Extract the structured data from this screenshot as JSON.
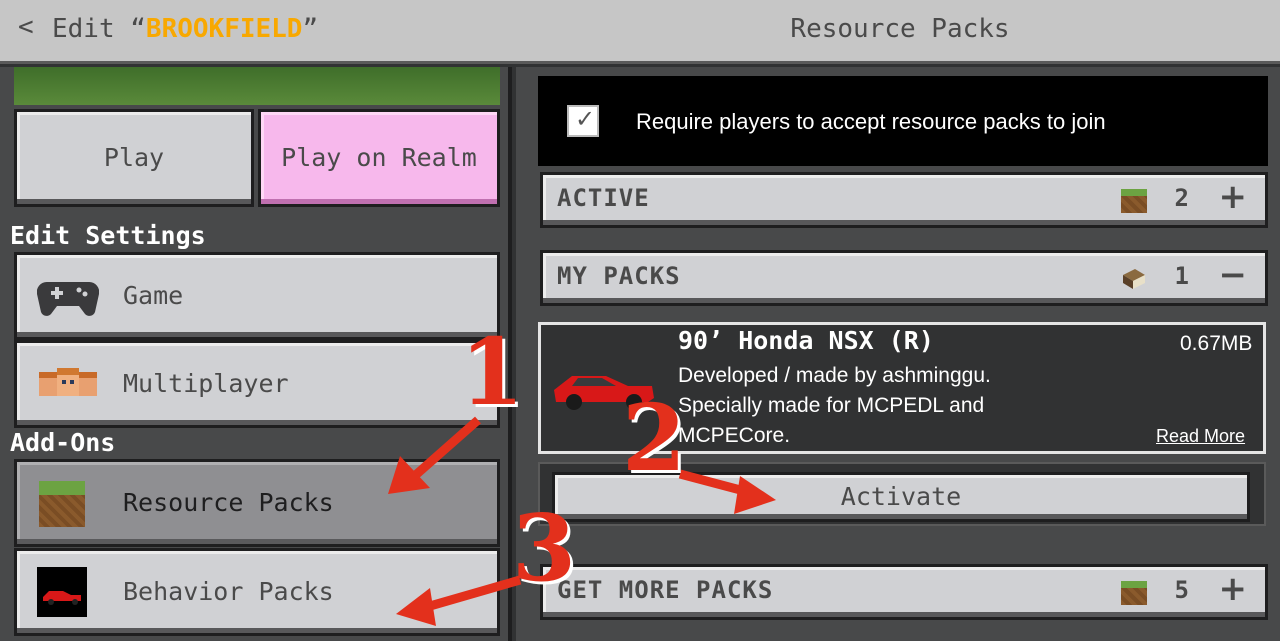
{
  "header": {
    "back_glyph": "<",
    "edit_prefix": "Edit “",
    "world_name": "BROOKFIELD",
    "edit_suffix": "”",
    "page_title": "Resource Packs"
  },
  "left": {
    "play_label": "Play",
    "realm_label": "Play on Realm",
    "edit_settings_heading": "Edit Settings",
    "game_label": "Game",
    "multiplayer_label": "Multiplayer",
    "addons_heading": "Add-Ons",
    "resource_packs_label": "Resource Packs",
    "behavior_packs_label": "Behavior Packs",
    "realm_color": "#f7b8ec"
  },
  "right": {
    "require_text": "Require players to accept resource packs to join",
    "require_checked": true,
    "active": {
      "label": "ACTIVE",
      "count": "2",
      "icon": "grass-block-icon",
      "action": "+"
    },
    "my_packs": {
      "label": "MY PACKS",
      "count": "1",
      "icon": "book-icon",
      "action": "−"
    },
    "pack": {
      "name": "90’ Honda NSX (R)",
      "size": "0.67MB",
      "description": "Developed / made by ashminggu.\nSpecially made for MCPEDL and\nMCPECore.",
      "read_more": "Read More",
      "icon": "red-car-icon"
    },
    "activate_label": "Activate",
    "get_more": {
      "label": "GET MORE PACKS",
      "count": "5",
      "icon": "grass-block-icon",
      "action": "+"
    }
  },
  "annotations": {
    "step1": "1",
    "step2": "2",
    "step3": "3",
    "color": "#e3301c"
  }
}
